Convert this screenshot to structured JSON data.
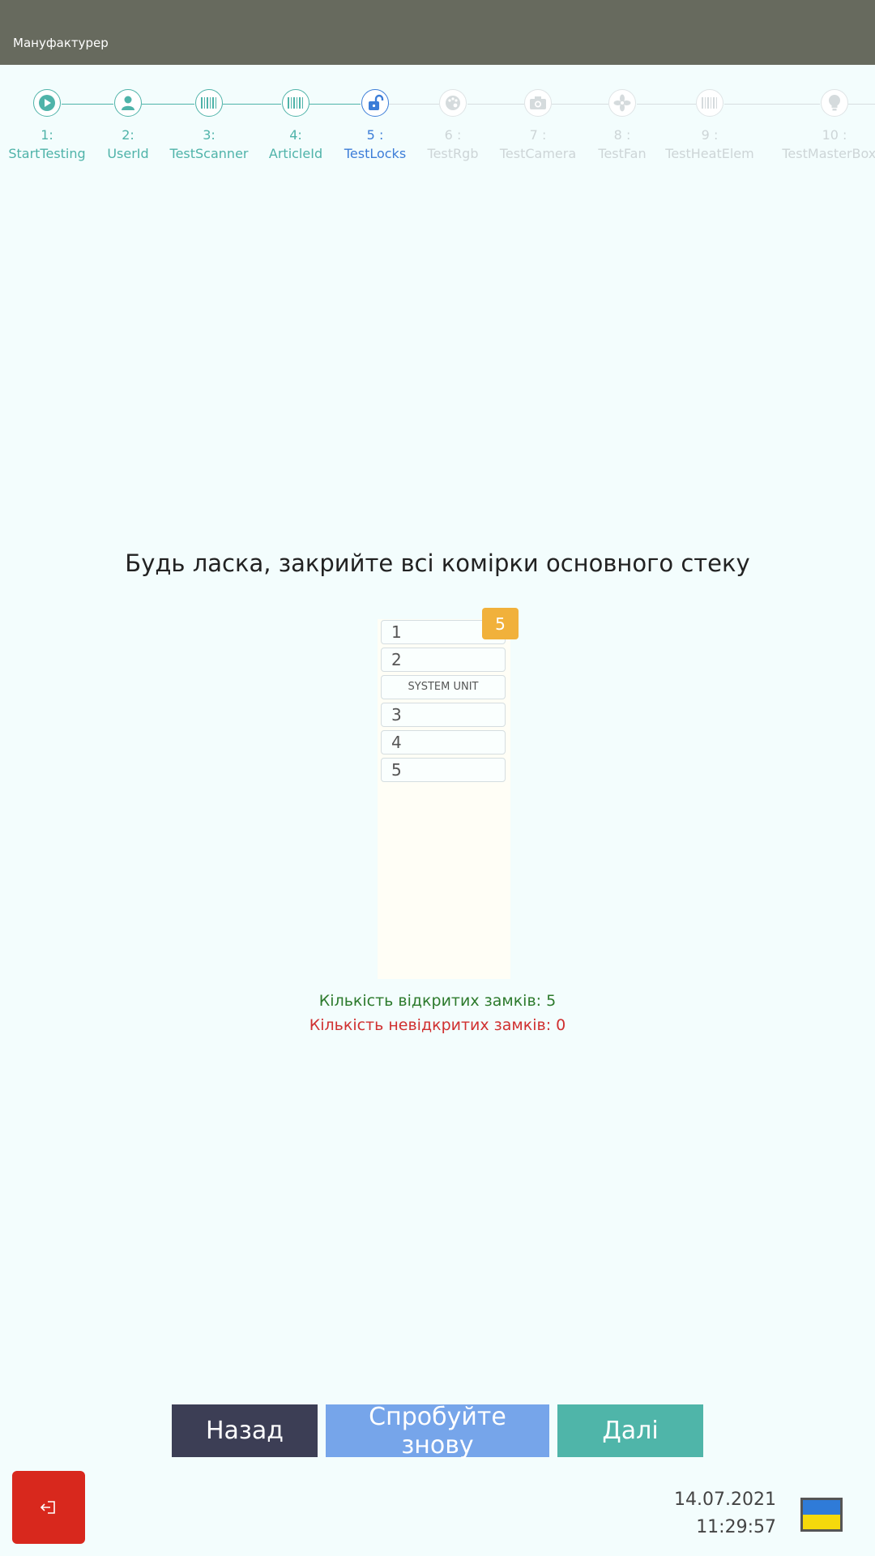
{
  "header": {
    "title": "Мануфактурер"
  },
  "steps": [
    {
      "num": "1:",
      "label": "StartTesting",
      "state": "done",
      "icon": "play-icon"
    },
    {
      "num": "2:",
      "label": "UserId",
      "state": "done",
      "icon": "user-icon"
    },
    {
      "num": "3:",
      "label": "TestScanner",
      "state": "done",
      "icon": "barcode-icon"
    },
    {
      "num": "4:",
      "label": "ArticleId",
      "state": "done",
      "icon": "barcode-icon"
    },
    {
      "num": "5 :",
      "label": "TestLocks",
      "state": "active",
      "icon": "unlock-icon"
    },
    {
      "num": "6 :",
      "label": "TestRgb",
      "state": "pending",
      "icon": "palette-icon"
    },
    {
      "num": "7 :",
      "label": "TestCamera",
      "state": "pending",
      "icon": "camera-icon"
    },
    {
      "num": "8 :",
      "label": "TestFan",
      "state": "pending",
      "icon": "fan-icon"
    },
    {
      "num": "9 :",
      "label": "TestHeatElem",
      "state": "pending",
      "icon": "barcode-icon"
    },
    {
      "num": "10 :",
      "label": "TestMasterBoxLi",
      "state": "pending",
      "icon": "bulb-icon"
    }
  ],
  "main": {
    "instruction": "Будь ласка, закрийте всі комірки основного стеку",
    "badge": "5",
    "cells": [
      "1",
      "2",
      "SYSTEM UNIT",
      "3",
      "4",
      "5"
    ],
    "open_locks": "Кількість відкритих замків: 5",
    "closed_locks": "Кількість невідкритих замків: 0"
  },
  "buttons": {
    "back": "Назад",
    "retry": "Спробуйте знову",
    "next": "Далі"
  },
  "footer": {
    "date": "14.07.2021",
    "time": "11:29:57",
    "language": "Ukrainian flag"
  },
  "colors": {
    "header_bg": "#676a5e",
    "done": "#4fb3a9",
    "active": "#3c7dd8",
    "pending": "#cdd5d7",
    "badge": "#f1b13b",
    "exit": "#d8281d"
  }
}
